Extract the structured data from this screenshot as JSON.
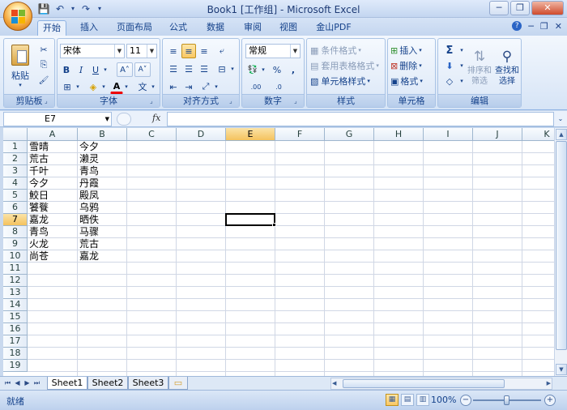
{
  "window": {
    "title": "Book1  [工作组] - Microsoft Excel",
    "minimize": "─",
    "restore": "❐",
    "close": "✕"
  },
  "qat": {
    "save_icon": "💾",
    "undo_icon": "↶",
    "redo_icon": "↷",
    "more_icon": "▾"
  },
  "tabs": [
    "开始",
    "插入",
    "页面布局",
    "公式",
    "数据",
    "审阅",
    "视图",
    "金山PDF"
  ],
  "active_tab": 0,
  "help": {
    "help_icon": "?",
    "minimize": "─",
    "restore": "❐",
    "close": "✕"
  },
  "ribbon": {
    "clipboard": {
      "label": "剪贴板",
      "paste": "粘贴",
      "cut_icon": "✂",
      "copy_icon": "⎘",
      "format_painter_icon": "🖌"
    },
    "font": {
      "label": "字体",
      "font_name": "宋体",
      "font_size": "11",
      "grow": "A˄",
      "shrink": "A˅",
      "bold": "B",
      "italic": "I",
      "underline": "U",
      "border_icon": "⊞",
      "fill_icon": "◈",
      "font_color": "A",
      "phonetic": "文"
    },
    "alignment": {
      "label": "对齐方式"
    },
    "number": {
      "label": "数字",
      "format": "常规",
      "currency": "💱",
      "percent": "%",
      "comma": ",",
      "inc_decimal": ".00",
      "dec_decimal": ".0"
    },
    "styles": {
      "label": "样式",
      "conditional": "条件格式",
      "table_format": "套用表格格式",
      "cell_styles": "单元格样式"
    },
    "cells": {
      "label": "单元格",
      "insert": "插入",
      "delete": "删除",
      "format": "格式"
    },
    "editing": {
      "label": "编辑",
      "autosum": "Σ",
      "fill": "⬇",
      "clear": "◇",
      "sort": "排序和\n筛选",
      "sort_line1": "排序和",
      "sort_line2": "筛选",
      "find_line1": "查找和",
      "find_line2": "选择"
    }
  },
  "formula_bar": {
    "name_box": "E7",
    "fx": "fx",
    "content": ""
  },
  "columns": [
    "A",
    "B",
    "C",
    "D",
    "E",
    "F",
    "G",
    "H",
    "I",
    "J",
    "K"
  ],
  "rows": [
    "1",
    "2",
    "3",
    "4",
    "5",
    "6",
    "7",
    "8",
    "9",
    "10",
    "11",
    "12",
    "13",
    "14",
    "15",
    "16",
    "17",
    "18",
    "19"
  ],
  "selected": {
    "col": "E",
    "row": "7"
  },
  "cells": {
    "A": [
      "雪晴",
      "荒古",
      "千叶",
      "今夕",
      "鮫日",
      "饕餮",
      "嘉龙",
      "青鸟",
      "火龙",
      "尚苍"
    ],
    "B": [
      "今夕",
      "濑灵",
      "青鸟",
      "丹霞",
      "殿凤",
      "乌鸦",
      "晒佚",
      "马骤",
      "荒古",
      "嘉龙"
    ]
  },
  "sheets": [
    "Sheet1",
    "Sheet2",
    "Sheet3"
  ],
  "active_sheet": 0,
  "status": {
    "text": "就绪",
    "zoom": "100%",
    "zoom_value": 100
  }
}
